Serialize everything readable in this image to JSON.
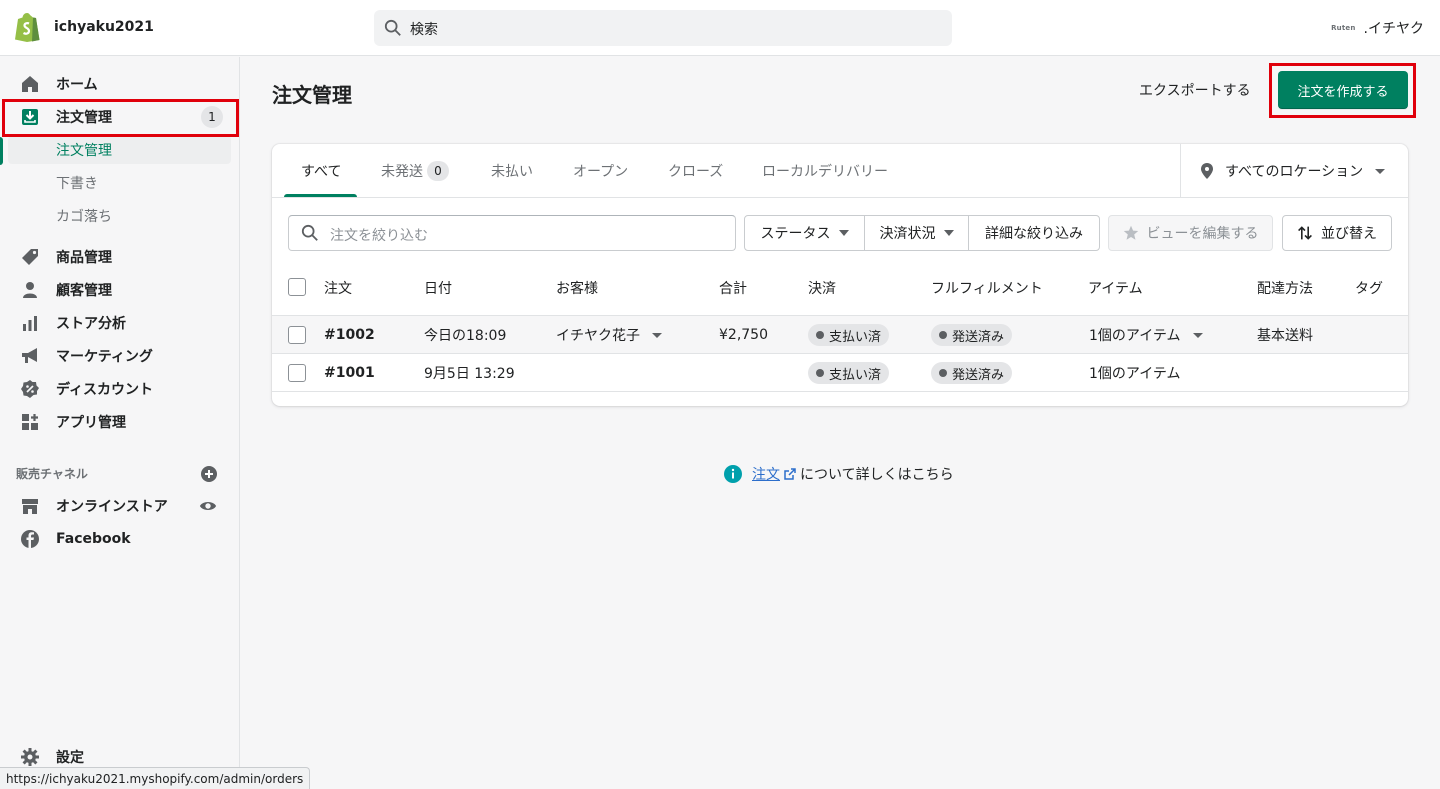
{
  "topbar": {
    "store_name": "ichyaku2021",
    "search_placeholder": "検索",
    "account_logo_text": "Ruten",
    "account_name": ".イチヤク"
  },
  "sidebar": {
    "items": [
      {
        "label": "ホーム",
        "icon": "home-icon"
      },
      {
        "label": "注文管理",
        "icon": "orders-icon",
        "badge": "1"
      },
      {
        "label": "商品管理",
        "icon": "tag-icon"
      },
      {
        "label": "顧客管理",
        "icon": "person-icon"
      },
      {
        "label": "ストア分析",
        "icon": "bar-chart-icon"
      },
      {
        "label": "マーケティング",
        "icon": "megaphone-icon"
      },
      {
        "label": "ディスカウント",
        "icon": "discount-icon"
      },
      {
        "label": "アプリ管理",
        "icon": "apps-icon"
      }
    ],
    "sub_items": [
      "注文管理",
      "下書き",
      "カゴ落ち"
    ],
    "channels_title": "販売チャネル",
    "channels": [
      {
        "label": "オンラインストア",
        "icon": "store-icon"
      },
      {
        "label": "Facebook",
        "icon": "facebook-icon"
      }
    ],
    "settings_label": "設定"
  },
  "main": {
    "title": "注文管理",
    "export_label": "エクスポートする",
    "create_label": "注文を作成する",
    "tabs": [
      {
        "label": "すべて"
      },
      {
        "label": "未発送",
        "badge": "0"
      },
      {
        "label": "未払い"
      },
      {
        "label": "オープン"
      },
      {
        "label": "クローズ"
      },
      {
        "label": "ローカルデリバリー"
      }
    ],
    "location_label": "すべてのロケーション",
    "filter_placeholder": "注文を絞り込む",
    "filters": {
      "status": "ステータス",
      "payment": "決済状況",
      "more": "詳細な絞り込み",
      "edit_view": "ビューを編集する",
      "sort": "並び替え"
    },
    "columns": [
      "注文",
      "日付",
      "お客様",
      "合計",
      "決済",
      "フルフィルメント",
      "アイテム",
      "配達方法",
      "タグ"
    ],
    "orders": [
      {
        "id": "#1002",
        "date": "今日の18:09",
        "customer": "イチヤク花子",
        "total": "¥2,750",
        "payment": "支払い済",
        "fulfillment": "発送済み",
        "items": "1個のアイテム",
        "delivery": "基本送料"
      },
      {
        "id": "#1001",
        "date": "9月5日 13:29",
        "customer": "",
        "total": "",
        "payment": "支払い済",
        "fulfillment": "発送済み",
        "items": "1個のアイテム",
        "delivery": ""
      }
    ],
    "learn_link": "注文",
    "learn_text": "について詳しくはこちら"
  },
  "status_url": "https://ichyaku2021.myshopify.com/admin/orders",
  "colors": {
    "brand": "#008060",
    "highlight": "#e0000b",
    "link": "#2c6ecb"
  }
}
